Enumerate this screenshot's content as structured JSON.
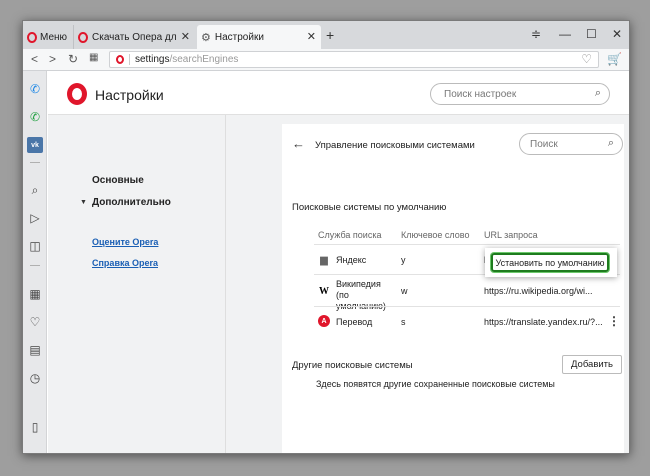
{
  "tabs": [
    {
      "label": "Меню"
    },
    {
      "label": "Скачать Опера для комп"
    },
    {
      "label": "Настройки"
    }
  ],
  "address": {
    "host": "settings",
    "path": "/searchEngines"
  },
  "header": {
    "title": "Настройки",
    "search_placeholder": "Поиск настроек"
  },
  "nav": {
    "basic": "Основные",
    "advanced": "Дополнительно",
    "rate": "Оцените Opera",
    "help": "Справка Opera"
  },
  "panel": {
    "title": "Управление поисковыми системами",
    "search_placeholder": "Поиск",
    "default_section": "Поисковые системы по умолчанию",
    "columns": [
      "Служба поиска",
      "Ключевое слово",
      "URL запроса"
    ],
    "engines": [
      {
        "name": "Яндекс",
        "keyword": "у",
        "url": "h",
        "icon": "document-icon"
      },
      {
        "name": "Википедия (по умолчанию)",
        "keyword": "w",
        "url": "https://ru.wikipedia.org/wi...",
        "icon": "wikipedia-icon"
      },
      {
        "name": "Перевод",
        "keyword": "s",
        "url": "https://translate.yandex.ru/?...",
        "icon": "translate-icon"
      }
    ],
    "set_default_label": "Установить по умолчанию",
    "other_section": "Другие поисковые системы",
    "add_label": "Добавить",
    "other_description": "Здесь появятся другие сохраненные поисковые системы"
  },
  "colors": {
    "opera_red": "#e0162b",
    "highlight_green": "#1e7b1e",
    "link_blue": "#1a5fb4"
  }
}
